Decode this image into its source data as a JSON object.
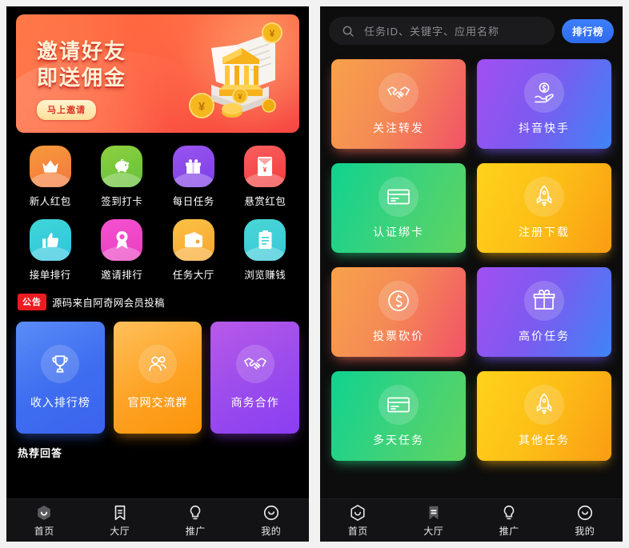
{
  "left_panel": {
    "banner": {
      "line1": "邀请好友",
      "line2": "即送佣金",
      "button": "马上邀请",
      "icon": "bank-coins-illustration"
    },
    "icon_grid": [
      {
        "label": "新人红包",
        "icon": "crown-icon",
        "color": "#f79a3c",
        "color2": "#f4763c"
      },
      {
        "label": "签到打卡",
        "icon": "piggy-bank-icon",
        "color": "#8fd13f",
        "color2": "#63c03a"
      },
      {
        "label": "每日任务",
        "icon": "gift-icon",
        "color": "#9a54f0",
        "color2": "#7b3fe4"
      },
      {
        "label": "悬赏红包",
        "icon": "red-envelope-icon",
        "color": "#fb5f5f",
        "color2": "#f03b3b"
      },
      {
        "label": "接单排行",
        "icon": "thumbs-up-icon",
        "color": "#3ed6d6",
        "color2": "#30c4e0"
      },
      {
        "label": "邀请排行",
        "icon": "medal-icon",
        "color": "#f552d0",
        "color2": "#e83ec0"
      },
      {
        "label": "任务大厅",
        "icon": "wallet-icon",
        "color": "#fcc146",
        "color2": "#f7a52e"
      },
      {
        "label": "浏览赚钱",
        "icon": "clipboard-icon",
        "color": "#4ad6d6",
        "color2": "#37c7d8"
      }
    ],
    "notice": {
      "badge": "公告",
      "text": "源码来自阿奇网会员投稿"
    },
    "promos": [
      {
        "label": "收入排行榜",
        "icon": "trophy-icon",
        "accent": "#3f6ef0"
      },
      {
        "label": "官网交流群",
        "icon": "group-icon",
        "accent": "#fda224"
      },
      {
        "label": "商务合作",
        "icon": "handshake-icon",
        "accent": "#9b4cec"
      }
    ],
    "tail_text": "热荐回答",
    "tabbar": [
      {
        "label": "首页",
        "icon": "home-hexagon-icon",
        "active": true
      },
      {
        "label": "大厅",
        "icon": "bookmark-icon",
        "active": false
      },
      {
        "label": "推广",
        "icon": "lightbulb-icon",
        "active": false
      },
      {
        "label": "我的",
        "icon": "smiley-circle-icon",
        "active": false
      }
    ]
  },
  "right_panel": {
    "search": {
      "placeholder": "任务ID、关键字、应用名称",
      "value": "",
      "icon": "search-icon"
    },
    "rank_button": "排行榜",
    "task_cards": [
      {
        "label": "关注转发",
        "icon": "handshake-icon",
        "theme": "t-orange"
      },
      {
        "label": "抖音快手",
        "icon": "hand-coin-icon",
        "theme": "t-purple"
      },
      {
        "label": "认证绑卡",
        "icon": "credit-card-icon",
        "theme": "t-green"
      },
      {
        "label": "注册下载",
        "icon": "rocket-icon",
        "theme": "t-yellow"
      },
      {
        "label": "投票砍价",
        "icon": "dollar-circle-icon",
        "theme": "t-orange"
      },
      {
        "label": "高价任务",
        "icon": "gift-icon",
        "theme": "t-purple"
      },
      {
        "label": "多天任务",
        "icon": "credit-card-icon",
        "theme": "t-green"
      },
      {
        "label": "其他任务",
        "icon": "rocket-icon",
        "theme": "t-yellow"
      }
    ],
    "tabbar": [
      {
        "label": "首页",
        "icon": "home-hexagon-icon",
        "active": false
      },
      {
        "label": "大厅",
        "icon": "bookmark-icon",
        "active": true
      },
      {
        "label": "推广",
        "icon": "lightbulb-icon",
        "active": false
      },
      {
        "label": "我的",
        "icon": "smiley-circle-icon",
        "active": false
      }
    ]
  },
  "colors": {
    "page_bg": "#f2f2f2",
    "phone_bg": "#000000",
    "tabbar_bg": "#131316",
    "accent_blue": "#3d7ffb",
    "notice_red": "#ea1c22"
  }
}
